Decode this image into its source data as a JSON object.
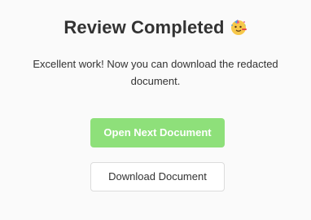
{
  "dialog": {
    "title": "Review Completed",
    "title_emoji": "partying-face-icon",
    "message": "Excellent work! Now you can download the redacted document."
  },
  "actions": {
    "open_next_label": "Open Next Document",
    "download_label": "Download Document"
  },
  "colors": {
    "background": "#fafafa",
    "primary_button": "#8ee07a",
    "text": "#333333"
  }
}
